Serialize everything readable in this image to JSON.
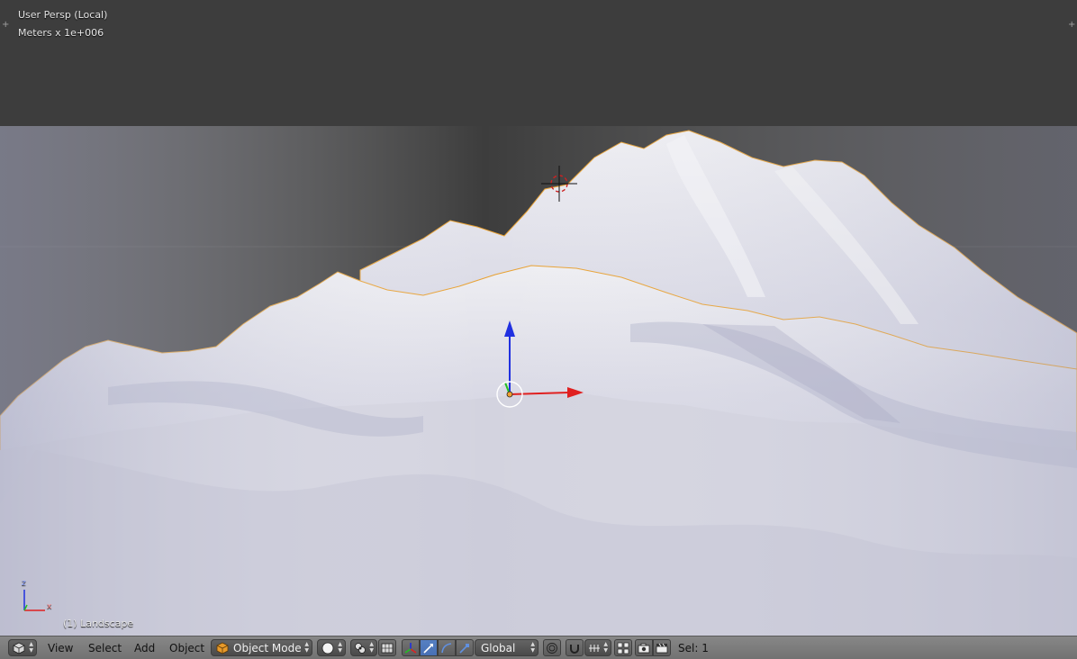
{
  "viewport": {
    "view_name": "User Persp (Local)",
    "units": "Meters x 1e+006",
    "object_label": "(1) Landscape",
    "mini_axis": {
      "z_label": "z",
      "x_label": "x"
    }
  },
  "header": {
    "menus": {
      "view": "View",
      "select": "Select",
      "add": "Add",
      "object": "Object"
    },
    "mode_dropdown": "Object Mode",
    "orientation_dropdown": "Global",
    "selection_info": "Sel: 1"
  },
  "icons": {
    "editor_type": "cube-icon",
    "viewport_shading": "solid-sphere-icon",
    "pivot": "pivot-point-icon",
    "manipulator": "manipulator-icon",
    "translate": "translate-arrow-icon",
    "rotate": "rotate-arc-icon",
    "scale": "scale-icon",
    "proportional": "proportional-edit-icon",
    "snap": "magnet-icon",
    "snap_element": "snap-increment-icon",
    "layers": "layers-icon",
    "render": "camera-icon",
    "render_anim": "clapper-icon"
  },
  "colors": {
    "viewport_bg": "#3d3d3d",
    "terrain": "#d8d8e4",
    "selection_outline": "#e8a030",
    "axis_x": "#e02020",
    "axis_y": "#20c020",
    "axis_z": "#2030e0",
    "active_button": "#5680c2"
  }
}
